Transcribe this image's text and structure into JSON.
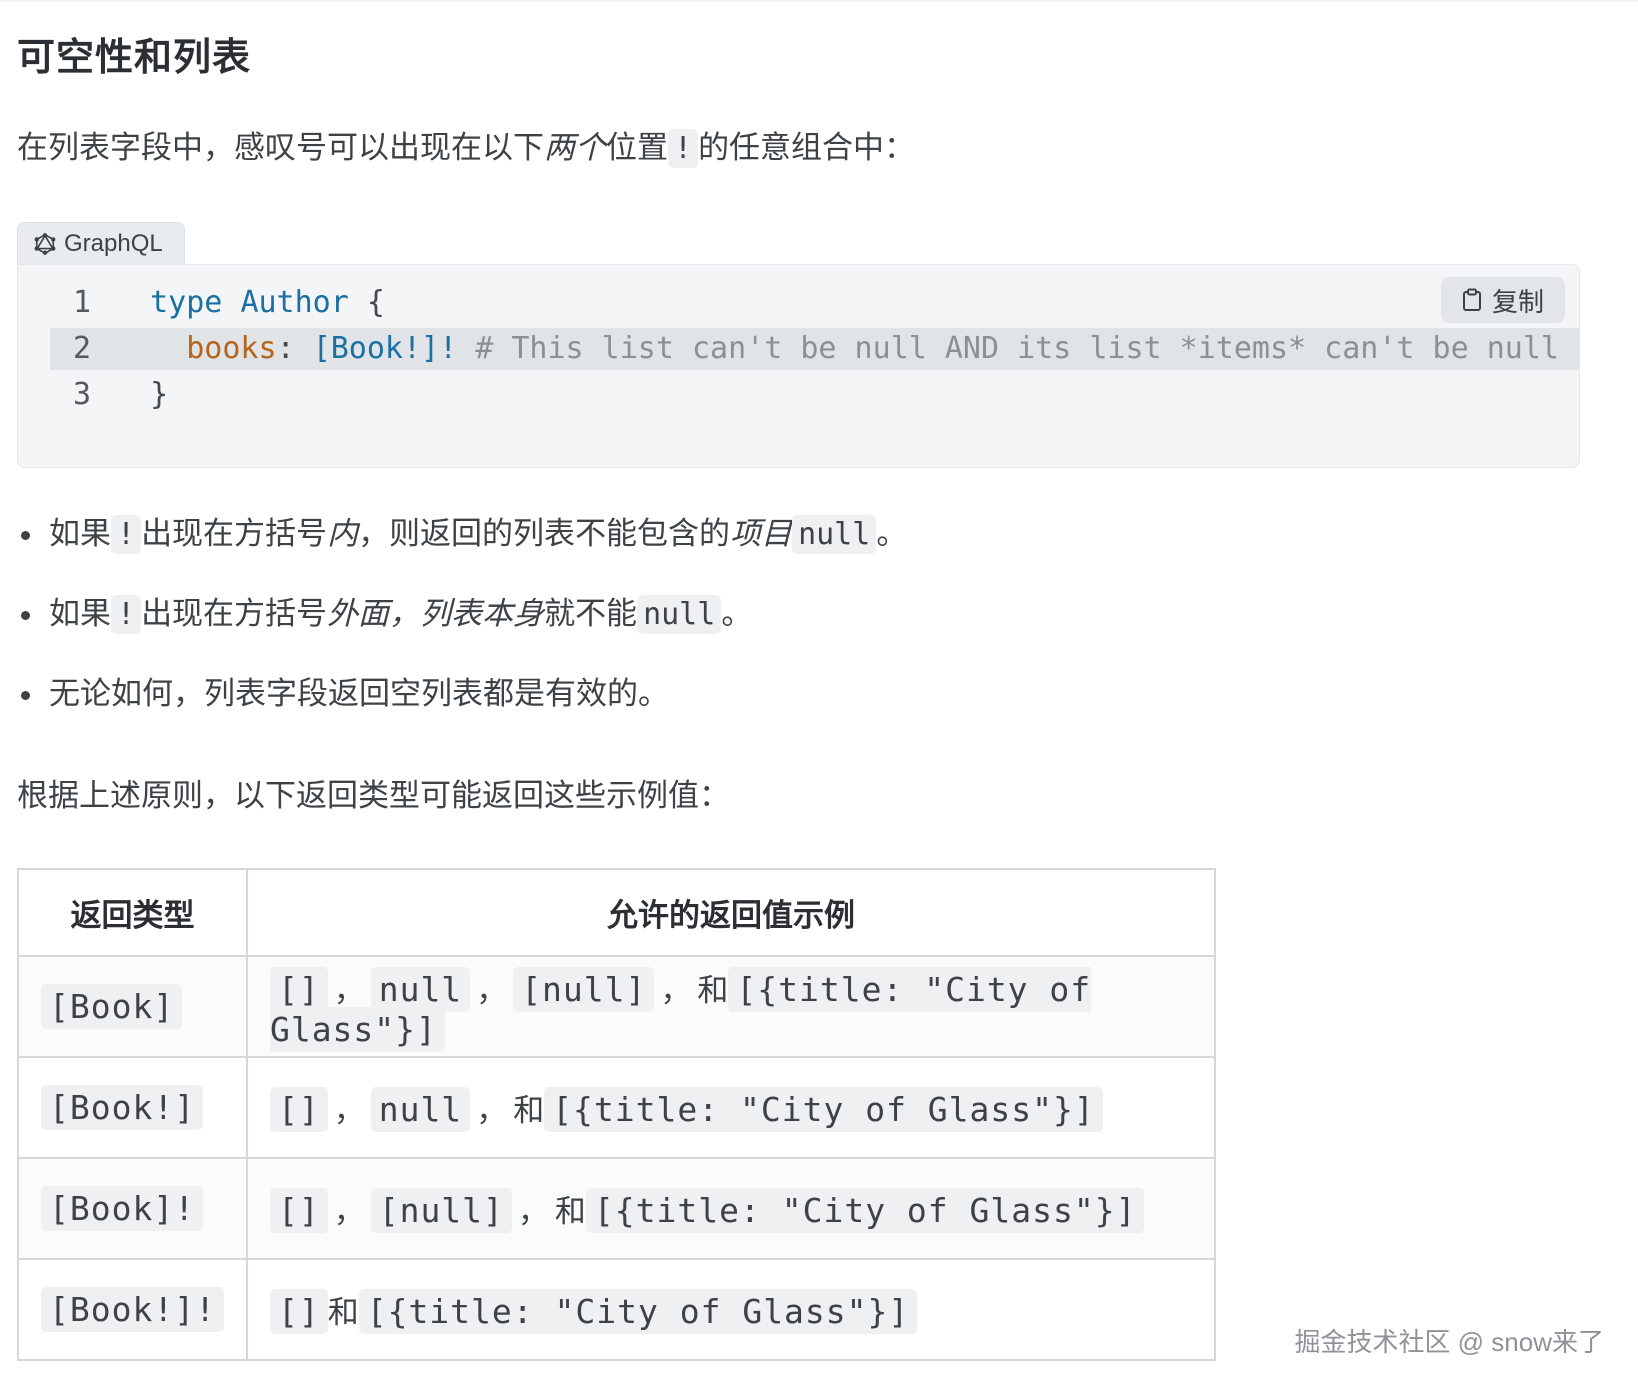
{
  "heading": "可空性和列表",
  "intro": {
    "text1": "在列表字段中，感叹号可以出现在以下",
    "emph": "两个",
    "text2": "位置",
    "code": "!",
    "text3": "的任意组合中："
  },
  "code_block": {
    "language_tab": "GraphQL",
    "copy_label": "复制",
    "lines": [
      {
        "num": "1",
        "keyword": "type",
        "name": "Author",
        "rest": " {"
      },
      {
        "num": "2",
        "field": "books",
        "colon": ": ",
        "type": "[Book!]!",
        "comment": " # This list can't be null AND its list *items* can't be null"
      },
      {
        "num": "3",
        "rest": "}"
      }
    ]
  },
  "bullets": [
    {
      "pre": "如果",
      "code1": "!",
      "mid": "出现在方括号",
      "emph": "内",
      "post": "，则返回的列表不能包含的",
      "emph2": "项目",
      "code2": "null",
      "end": "。"
    },
    {
      "pre": "如果",
      "code1": "!",
      "mid": "出现在方括号",
      "emph": "外面，",
      "emph2": "列表本身",
      "post": "就不能",
      "code2": "null",
      "end": "。"
    },
    {
      "text": "无论如何，列表字段返回空列表都是有效的。"
    }
  ],
  "summary": "根据上述原则，以下返回类型可能返回这些示例值：",
  "table": {
    "headers": [
      "返回类型",
      "允许的返回值示例"
    ],
    "rows": [
      {
        "type": "[Book]",
        "v1": "[]",
        "s1": "，",
        "v2": "null",
        "s2": "，",
        "v3": "[null]",
        "s3": "，",
        "and": "和",
        "v4": "[{title: \"City of Glass\"}]"
      },
      {
        "type": "[Book!]",
        "v1": "[]",
        "s1": "，",
        "v2": "null",
        "s2": "，",
        "and": "和",
        "v4": "[{title: \"City of Glass\"}]"
      },
      {
        "type": "[Book]!",
        "v1": "[]",
        "s1": "，",
        "v3": "[null]",
        "s3": "，",
        "and": "和",
        "v4": "[{title: \"City of Glass\"}]"
      },
      {
        "type": "[Book!]!",
        "v1": "[]",
        "and": "和",
        "v4": "[{title: \"City of Glass\"}]"
      }
    ]
  },
  "watermark": "掘金技术社区 @ snow来了"
}
